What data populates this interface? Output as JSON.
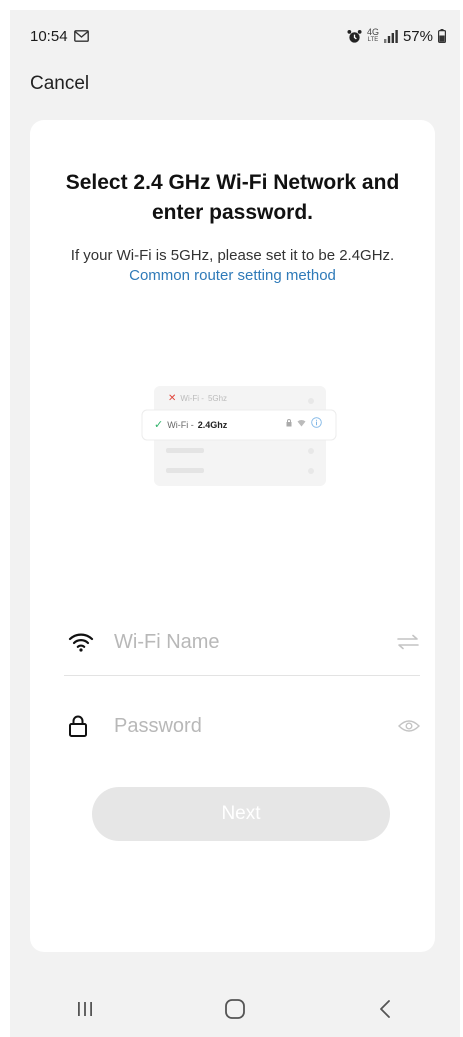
{
  "status_bar": {
    "time": "10:54",
    "network_badge_top": "4G",
    "network_badge_bottom": "LTE",
    "battery": "57%"
  },
  "header": {
    "cancel_label": "Cancel"
  },
  "card": {
    "title": "Select 2.4 GHz Wi-Fi Network and enter password.",
    "subtitle_text": "If your Wi-Fi is 5GHz, please set it to be 2.4GHz.",
    "subtitle_link": "Common router setting method",
    "illustration": {
      "row_5g_prefix": "Wi-Fi - ",
      "row_5g_band": "5Ghz",
      "row_24g_prefix": "Wi-Fi - ",
      "row_24g_band": "2.4Ghz"
    },
    "wifi_field": {
      "placeholder": "Wi-Fi Name",
      "value": ""
    },
    "password_field": {
      "placeholder": "Password",
      "value": ""
    },
    "next_label": "Next"
  },
  "colors": {
    "link": "#2f7ab8",
    "button_disabled": "#e6e6e6",
    "check_green": "#2fb36a",
    "cross_red": "#e0463c"
  },
  "icons": {
    "status_left": "gmail-icon",
    "status_right": [
      "alarm-icon",
      "signal-icon",
      "battery-icon"
    ],
    "wifi": "wifi-icon",
    "lock": "lock-icon",
    "switch": "switch-arrows-icon",
    "eye": "eye-icon"
  }
}
